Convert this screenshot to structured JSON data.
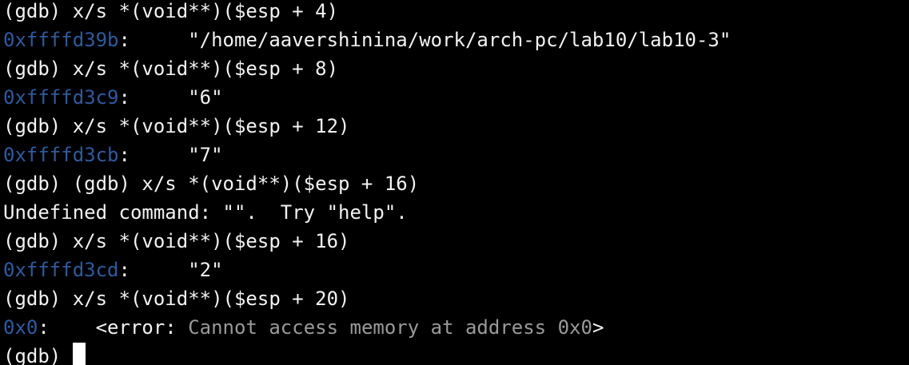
{
  "colors": {
    "background": "#000000",
    "foreground": "#f2f2f2",
    "address": "#2f5a9e",
    "dim_text": "#9a9a9a",
    "cursor": "#ffffff"
  },
  "lines": [
    {
      "text": "(gdb) x/s *(void**)($esp + 4)"
    },
    {
      "addr": "0xffffd39b",
      "sep": ":",
      "gap": "     ",
      "value": "\"/home/aavershinina/work/arch-pc/lab10/lab10-3\""
    },
    {
      "text": "(gdb) x/s *(void**)($esp + 8)"
    },
    {
      "addr": "0xffffd3c9",
      "sep": ":",
      "gap": "     ",
      "value": "\"6\""
    },
    {
      "text": "(gdb) x/s *(void**)($esp + 12)"
    },
    {
      "addr": "0xffffd3cb",
      "sep": ":",
      "gap": "     ",
      "value": "\"7\""
    },
    {
      "text": "(gdb) (gdb) x/s *(void**)($esp + 16)"
    },
    {
      "text": "Undefined command: \"\".  Try \"help\"."
    },
    {
      "text": "(gdb) x/s *(void**)($esp + 16)"
    },
    {
      "addr": "0xffffd3cd",
      "sep": ":",
      "gap": "     ",
      "value": "\"2\""
    },
    {
      "text": "(gdb) x/s *(void**)($esp + 20)"
    },
    {
      "addr": "0x0",
      "sep": ":",
      "gap": "    ",
      "value": "<error: ",
      "dim": "Cannot access memory at address 0x0",
      "value_end": ">"
    },
    {
      "prompt": "(gdb) "
    }
  ]
}
